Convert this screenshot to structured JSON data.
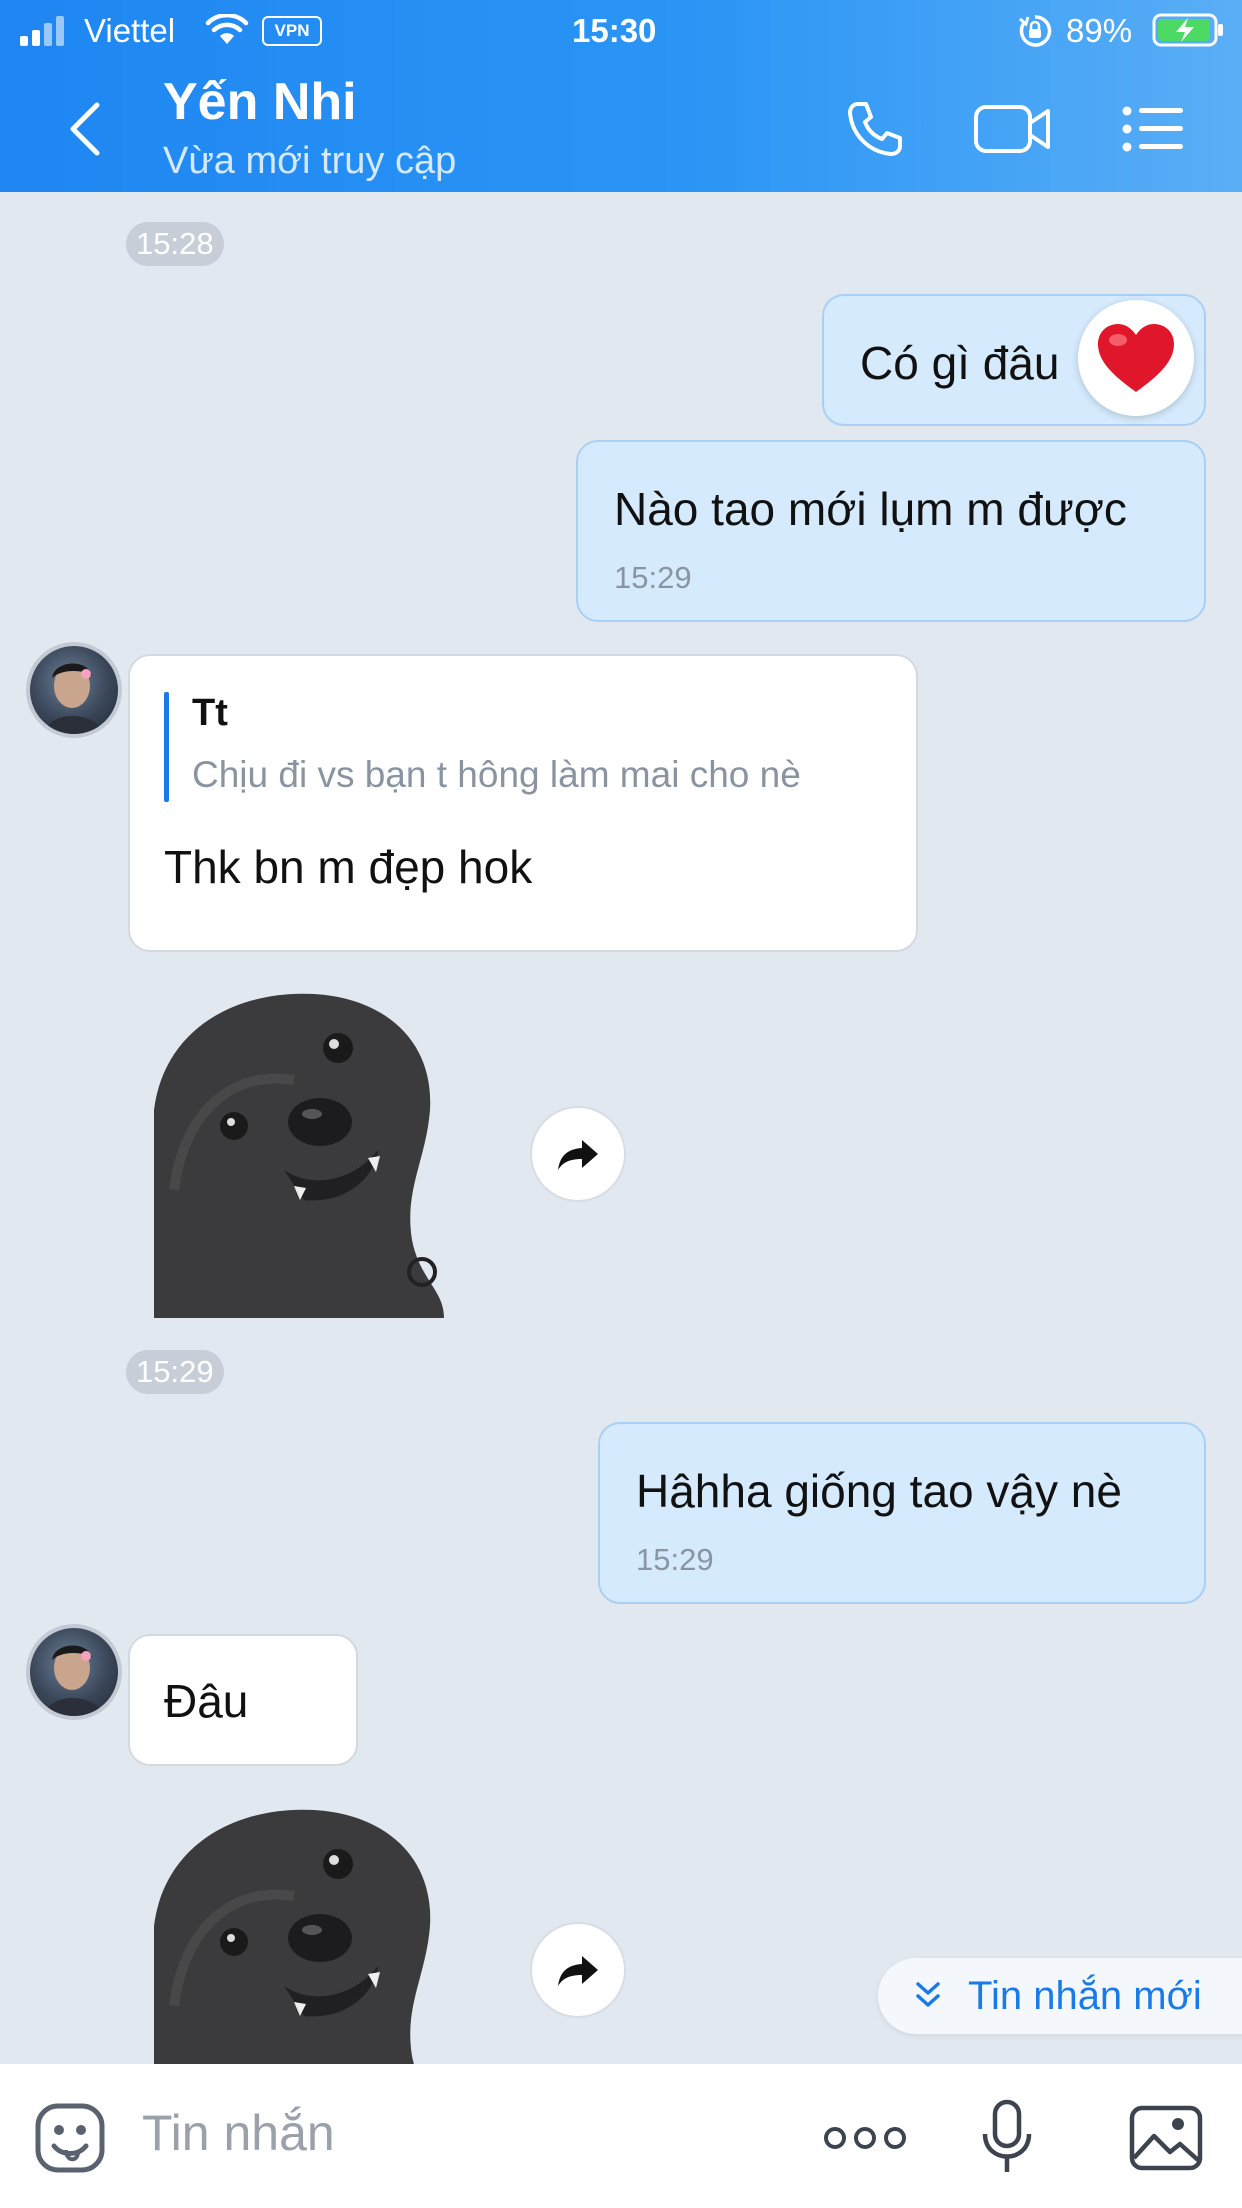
{
  "status_bar": {
    "carrier": "Viettel",
    "vpn": "VPN",
    "time": "15:30",
    "battery": "89%"
  },
  "header": {
    "title": "Yến Nhi",
    "subtitle": "Vừa mới truy cập"
  },
  "messages": {
    "time1": "15:28",
    "m1_text": "Có gì đâu",
    "m1_reaction": "❤️",
    "m2_text": "Nào tao mới lụm m được",
    "m2_time": "15:29",
    "m3_quote_author": "Tt",
    "m3_quote_text": "Chịu đi vs bạn t hông làm mai cho nè",
    "m3_text": "Thk bn m đẹp hok",
    "time2": "15:29",
    "m5_text": "Hâhha giống tao vậy nè",
    "m5_time": "15:29",
    "m6_text": "Đâu"
  },
  "new_messages": {
    "label": "Tin nhắn mới"
  },
  "composer": {
    "placeholder": "Tin nhắn"
  },
  "colors": {
    "header_start": "#1f86f2",
    "chat_bg": "#e2e8ef",
    "outgoing_bubble": "#d5ebfd",
    "incoming_bubble": "#ffffff",
    "accent": "#1a7ae8"
  }
}
